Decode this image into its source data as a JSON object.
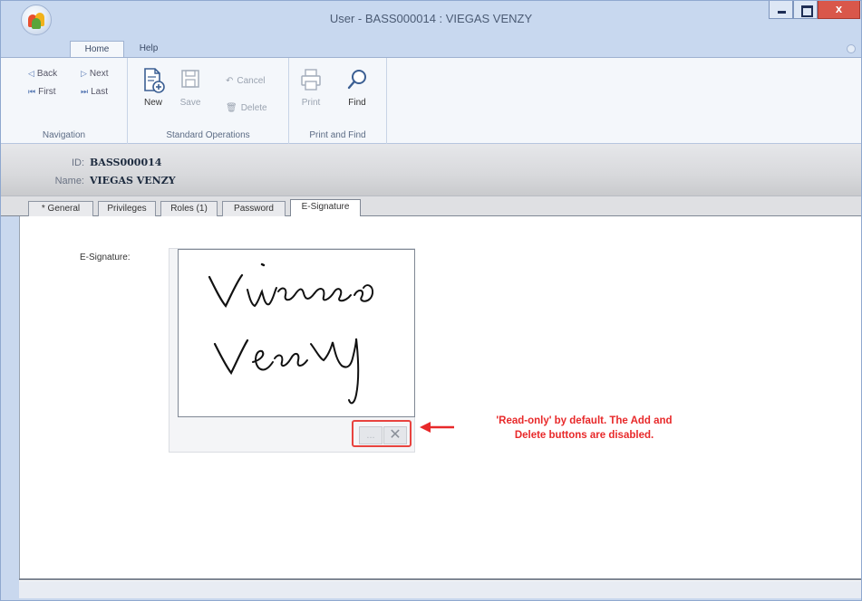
{
  "window": {
    "title": "User - BASS000014 : VIEGAS VENZY",
    "colors": {
      "frame": "#c9d8ee",
      "close": "#d9574a",
      "annotation": "#e8292a"
    }
  },
  "ribbon": {
    "tabs": [
      "Home",
      "Help"
    ],
    "navigation": {
      "label": "Navigation",
      "items": [
        {
          "label": "Back",
          "icon": "arrow-left-icon"
        },
        {
          "label": "Next",
          "icon": "arrow-right-icon"
        },
        {
          "label": "First",
          "icon": "first-icon"
        },
        {
          "label": "Last",
          "icon": "last-icon"
        }
      ]
    },
    "standard": {
      "label": "Standard Operations",
      "new": "New",
      "save": "Save",
      "cancel": "Cancel",
      "delete": "Delete"
    },
    "print_find": {
      "label": "Print and Find",
      "print": "Print",
      "find": "Find"
    }
  },
  "record": {
    "id_label": "ID:",
    "id_value": "BASS000014",
    "name_label": "Name:",
    "name_value": "VIEGAS VENZY"
  },
  "tabs": [
    "* General",
    "Privileges",
    "Roles (1)",
    "Password",
    "E-Signature"
  ],
  "active_tab": "E-Signature",
  "signature": {
    "label": "E-Signature:",
    "add_label": "...",
    "delete_label": "✕"
  },
  "annotation": {
    "line1": "'Read-only' by default. The Add and",
    "line2": "Delete buttons are disabled."
  }
}
